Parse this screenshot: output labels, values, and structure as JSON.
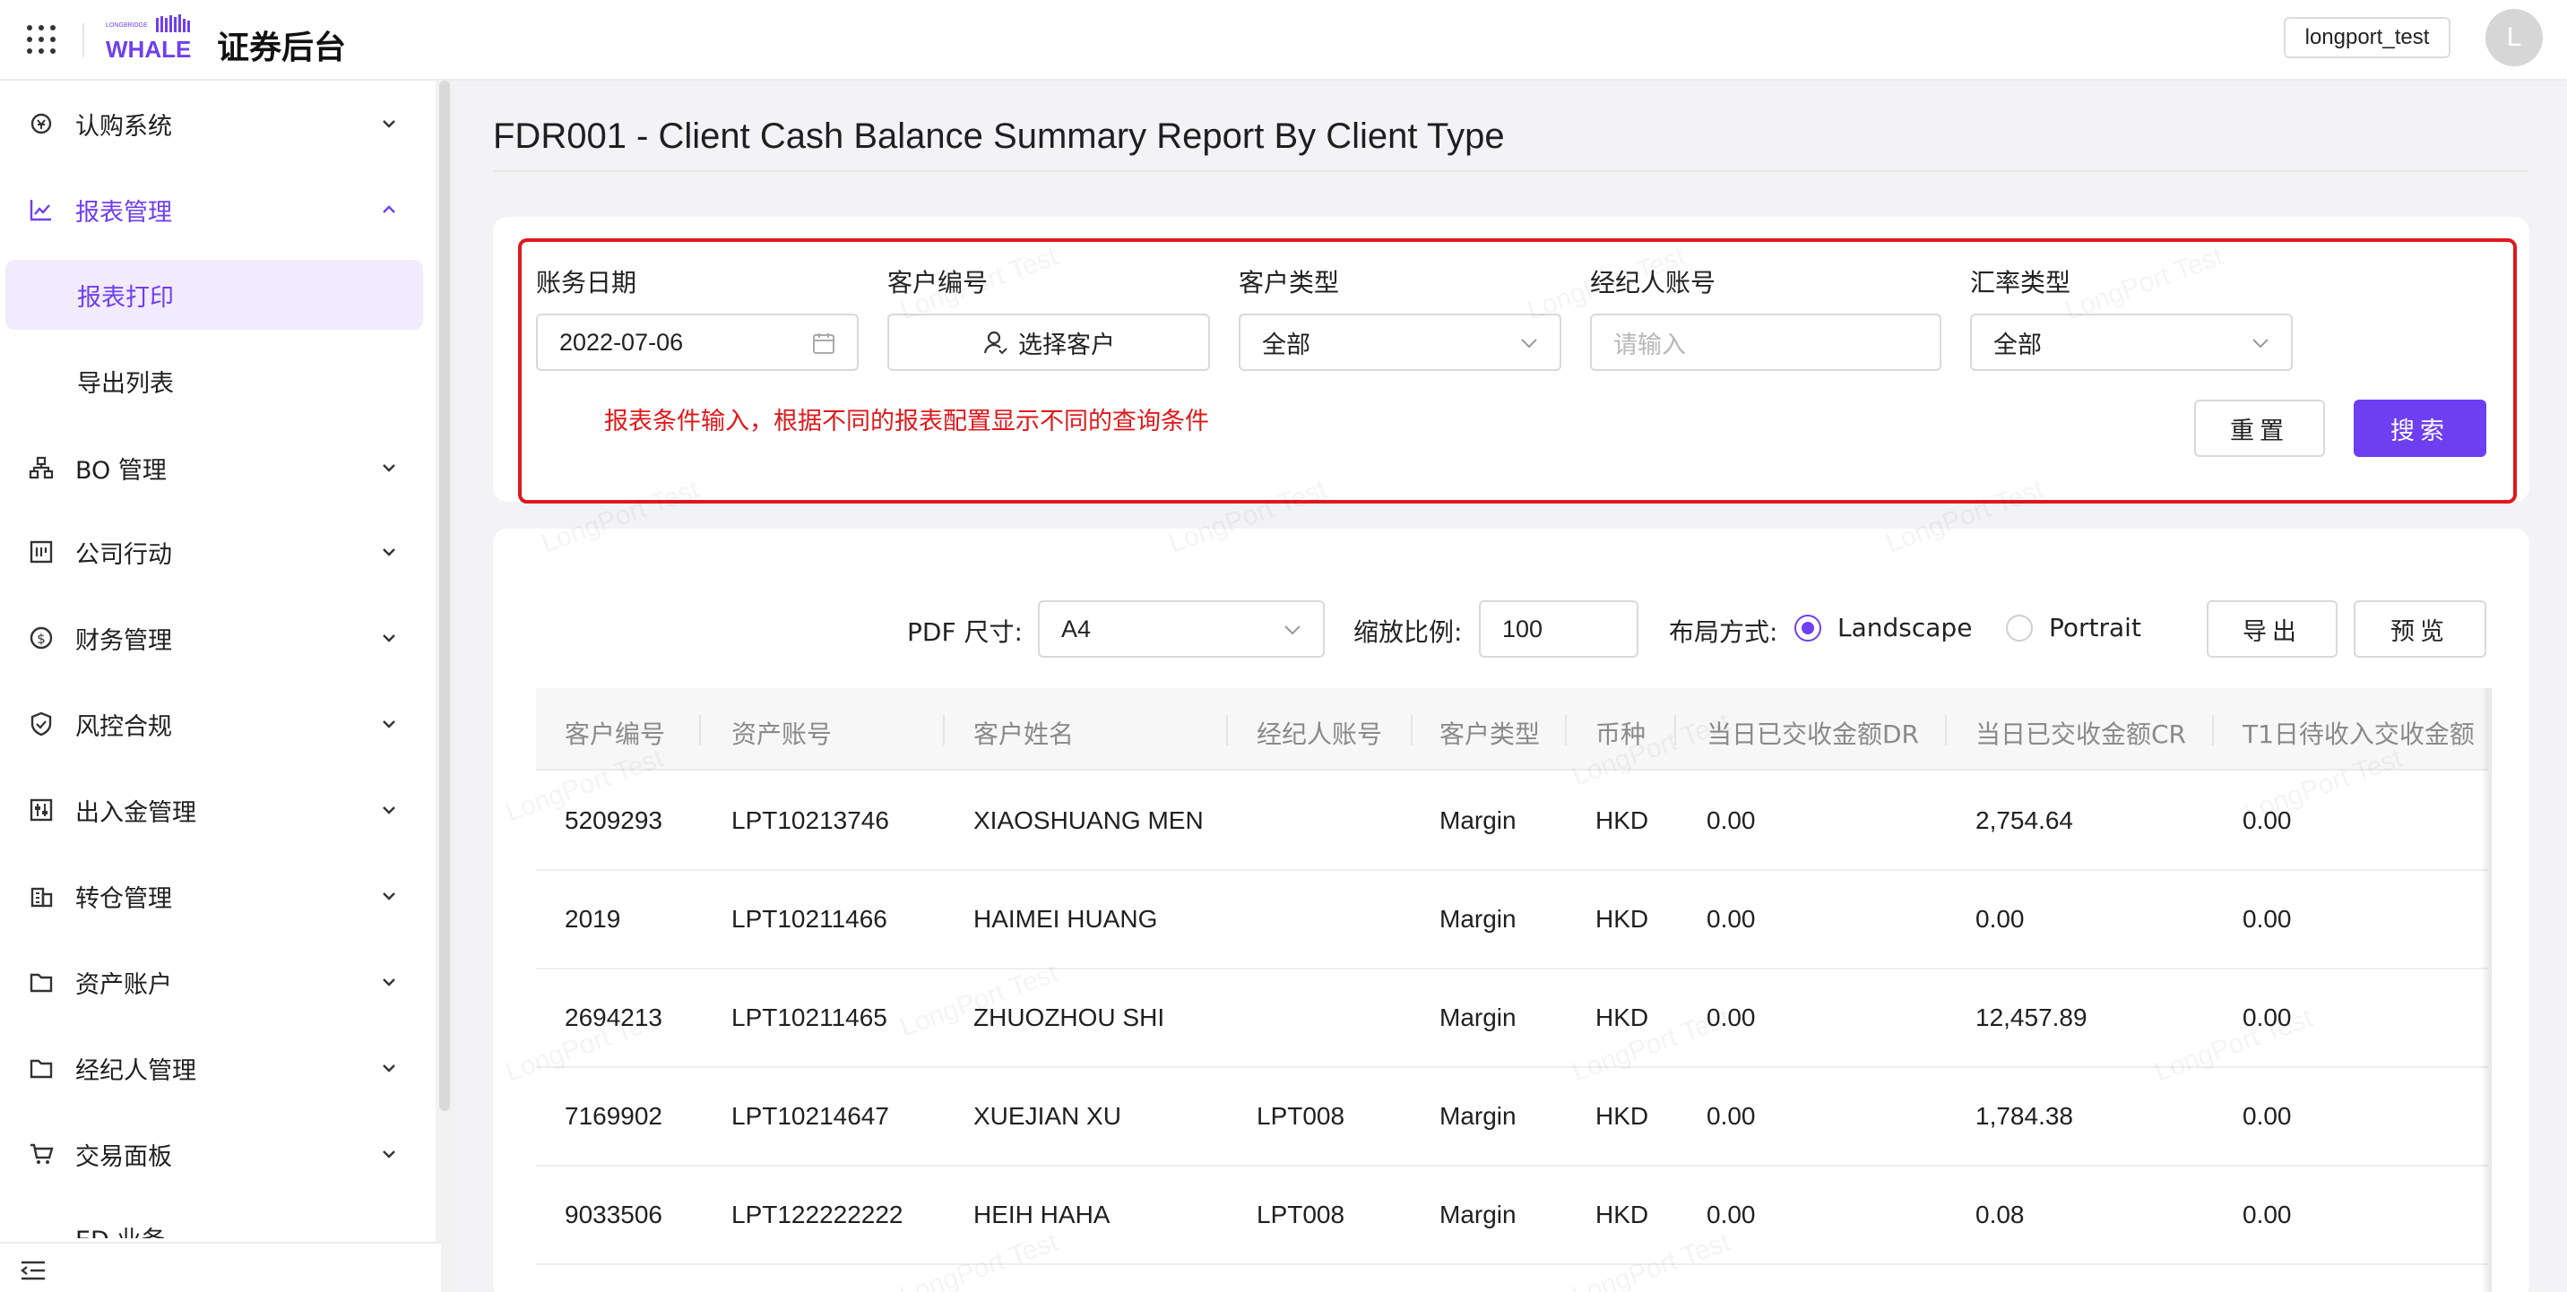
{
  "header": {
    "app_title": "证券后台",
    "logo_small_text": "LONGBRIDGE",
    "logo_text": "WHALE",
    "user": "longport_test",
    "avatar_initial": "L"
  },
  "sidebar": {
    "items": [
      {
        "label": "认购系统",
        "icon": "subscription-icon"
      },
      {
        "label": "报表管理",
        "icon": "chart-icon"
      },
      {
        "label": "BO 管理",
        "icon": "org-chart-icon"
      },
      {
        "label": "公司行动",
        "icon": "calendar-icon"
      },
      {
        "label": "财务管理",
        "icon": "dollar-icon"
      },
      {
        "label": "风控合规",
        "icon": "shield-icon"
      },
      {
        "label": "出入金管理",
        "icon": "sliders-icon"
      },
      {
        "label": "转仓管理",
        "icon": "building-icon"
      },
      {
        "label": "资产账户",
        "icon": "folder-icon"
      },
      {
        "label": "经纪人管理",
        "icon": "folder-icon"
      },
      {
        "label": "交易面板",
        "icon": "cart-icon"
      },
      {
        "label": "ED 业务",
        "icon": "folder-icon"
      }
    ],
    "sub_items": [
      {
        "label": "报表打印"
      },
      {
        "label": "导出列表"
      }
    ]
  },
  "page": {
    "title": "FDR001 - Client Cash Balance Summary Report By Client Type"
  },
  "filters": {
    "date_label": "账务日期",
    "date_value": "2022-07-06",
    "client_no_label": "客户编号",
    "client_no_button": "选择客户",
    "client_type_label": "客户类型",
    "client_type_value": "全部",
    "broker_label": "经纪人账号",
    "broker_placeholder": "请输入",
    "fx_label": "汇率类型",
    "fx_value": "全部",
    "note": "报表条件输入，根据不同的报表配置显示不同的查询条件",
    "reset": "重置",
    "search": "搜索"
  },
  "toolbar": {
    "pdf_label": "PDF 尺寸:",
    "pdf_value": "A4",
    "zoom_label": "缩放比例:",
    "zoom_value": "100",
    "layout_label": "布局方式:",
    "landscape": "Landscape",
    "portrait": "Portrait",
    "layout_selected": "Landscape",
    "export": "导出",
    "preview": "预览"
  },
  "table": {
    "headers": [
      "客户编号",
      "资产账号",
      "客户姓名",
      "经纪人账号",
      "客户类型",
      "币种",
      "当日已交收金额DR",
      "当日已交收金额CR",
      "T1日待收入交收金额"
    ],
    "rows": [
      [
        "5209293",
        "LPT10213746",
        "XIAOSHUANG MEN",
        "",
        "Margin",
        "HKD",
        "0.00",
        "2,754.64",
        "0.00"
      ],
      [
        "2019",
        "LPT10211466",
        "HAIMEI HUANG",
        "",
        "Margin",
        "HKD",
        "0.00",
        "0.00",
        "0.00"
      ],
      [
        "2694213",
        "LPT10211465",
        "ZHUOZHOU SHI",
        "",
        "Margin",
        "HKD",
        "0.00",
        "12,457.89",
        "0.00"
      ],
      [
        "7169902",
        "LPT10214647",
        "XUEJIAN XU",
        "LPT008",
        "Margin",
        "HKD",
        "0.00",
        "1,784.38",
        "0.00"
      ],
      [
        "9033506",
        "LPT122222222",
        "HEIH HAHA",
        "LPT008",
        "Margin",
        "HKD",
        "0.00",
        "0.08",
        "0.00"
      ]
    ]
  },
  "watermark": "LongPort Test",
  "colors": {
    "accent": "#6e3ff0",
    "annotation_red": "#e0181b"
  }
}
